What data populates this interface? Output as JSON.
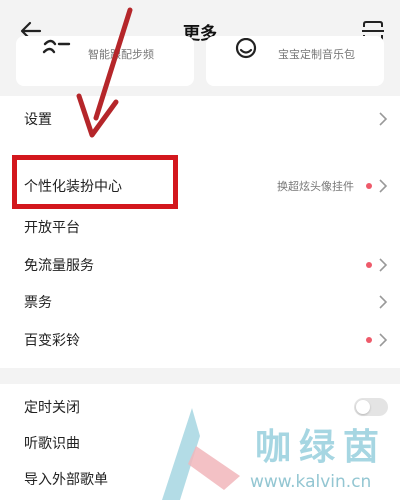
{
  "header": {
    "title": "更多",
    "back_icon": "back-arrow-icon",
    "right_icon": "scan-icon"
  },
  "top_cards": [
    {
      "label": "智能跟配步频",
      "icon": "running-icon"
    },
    {
      "label": "宝宝定制音乐包",
      "icon": "baby-icon"
    }
  ],
  "menu": {
    "settings": {
      "label": "设置"
    },
    "decoration_center": {
      "label": "个性化装扮中心",
      "hint": "换超炫头像挂件"
    },
    "open_platform": {
      "label": "开放平台"
    },
    "free_data": {
      "label": "免流量服务"
    },
    "tickets": {
      "label": "票务"
    },
    "ringtone": {
      "label": "百变彩铃"
    },
    "sleep_timer": {
      "label": "定时关闭",
      "enabled": false
    },
    "song_recognition": {
      "label": "听歌识曲"
    },
    "import_playlist": {
      "label": "导入外部歌单"
    }
  },
  "colors": {
    "highlight": "#d3171d",
    "notice_dot": "#ee5a6a",
    "watermark": "#a6d6e2"
  },
  "watermark": {
    "text": "咖绿茵",
    "url": "www.kalvin.cn"
  }
}
